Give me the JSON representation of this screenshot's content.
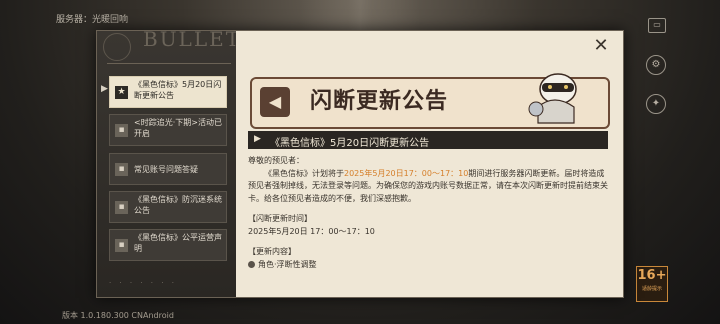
{
  "background": {
    "server_label": "服务器：光暖回响",
    "version_label": "版本 1.0.180.300 CNAndroid"
  },
  "dialog": {
    "header_title": "BULLET",
    "close_icon": "close-icon",
    "menu_items": [
      {
        "label": "《黑色信标》5月20日闪断更新公告",
        "icon": "bookmark-icon",
        "active": true
      },
      {
        "label": "<时踪追光·下期>活动已开启",
        "icon": "bookmark-icon",
        "active": false
      },
      {
        "label": "常见账号问题答疑",
        "icon": "bookmark-icon",
        "active": false
      },
      {
        "label": "《黑色信标》防沉迷系统公告",
        "icon": "bookmark-icon",
        "active": false
      },
      {
        "label": "《黑色信标》公平运营声明",
        "icon": "bookmark-icon",
        "active": false
      }
    ]
  },
  "article": {
    "banner_title": "闪断更新公告",
    "heading": "《黑色信标》5月20日闪断更新公告",
    "greeting": "尊敬的预见者：",
    "p1_before": "《黑色信标》计划将于",
    "p1_highlight": "2025年5月20日17：00～17：10",
    "p1_after": "期间进行服务器闪断更新。届时将造成预见者强制掉线，无法登录等问题。为确保您的游戏内账号数据正常，请在本次闪断更新时提前结束关卡。给各位预见者造成的不便，我们深感抱歉。",
    "section1_title": "【闪断更新时间】",
    "section1_value": "2025年5月20日 17：00～17：10",
    "section2_title": "【更新内容】",
    "section2_item": "角色·浮断性调整"
  },
  "rating_badge": {
    "age": "16+",
    "caption": "适龄提示"
  },
  "colors": {
    "accent": "#d57f2a",
    "panel": "#efe7d6",
    "dark": "#2a2622"
  }
}
